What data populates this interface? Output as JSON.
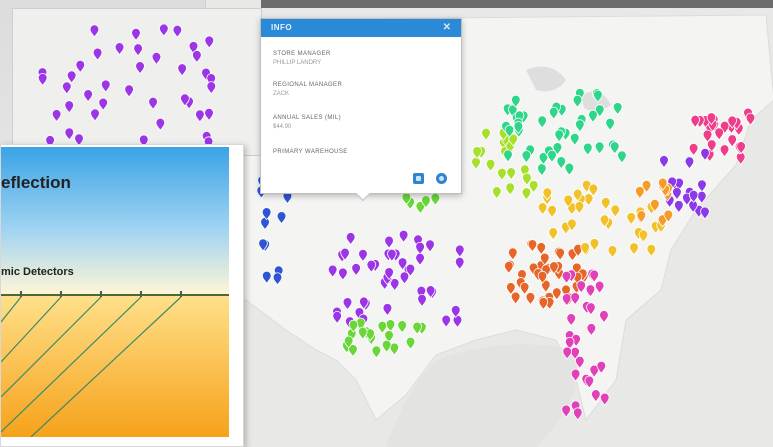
{
  "popup": {
    "header": "INFO",
    "close_glyph": "✕",
    "fields": [
      {
        "label": "STORE MANAGER",
        "value": "PHILLIP LANDRY"
      },
      {
        "label": "REGIONAL MANAGER",
        "value": "ZACK"
      },
      {
        "label": "ANNUAL SALES (MIL)",
        "value": "$44.90"
      },
      {
        "label": "PRIMARY WAREHOUSE",
        "value": ""
      }
    ]
  },
  "slide": {
    "title": "eflection",
    "subtitle": "mic Detectors"
  },
  "colors": {
    "popup_header": "#2b8ad8",
    "ocean": "#e8e8e6",
    "land": "#f5f5f3"
  }
}
